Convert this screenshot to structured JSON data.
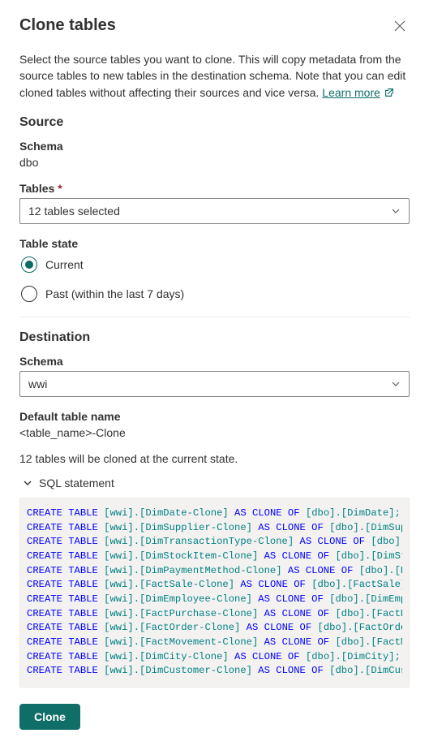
{
  "header": {
    "title": "Clone tables"
  },
  "intro": {
    "text": "Select the source tables you want to clone. This will copy metadata from the source tables to new tables in the destination schema. Note that you can edit cloned tables without affecting their sources and vice versa. ",
    "learn_more": "Learn more"
  },
  "source": {
    "title": "Source",
    "schema_label": "Schema",
    "schema_value": "dbo",
    "tables_label": "Tables",
    "tables_required": "*",
    "tables_selected": "12 tables selected",
    "state_label": "Table state",
    "state_current": "Current",
    "state_past": "Past (within the last 7 days)"
  },
  "destination": {
    "title": "Destination",
    "schema_label": "Schema",
    "schema_value": "wwi",
    "default_label": "Default table name",
    "default_value": "<table_name>-Clone"
  },
  "summary": "12 tables will be cloned at the current state.",
  "sql": {
    "label": "SQL statement",
    "kw_create": "CREATE",
    "kw_table": "TABLE",
    "kw_as": "AS",
    "kw_clone": "CLONE",
    "kw_of": "OF",
    "rows": [
      {
        "dest": "[wwi].[DimDate-Clone]",
        "src": "[dbo].[DimDate];"
      },
      {
        "dest": "[wwi].[DimSupplier-Clone]",
        "src": "[dbo].[DimSupplier];"
      },
      {
        "dest": "[wwi].[DimTransactionType-Clone]",
        "src": "[dbo].[DimTra"
      },
      {
        "dest": "[wwi].[DimStockItem-Clone]",
        "src": "[dbo].[DimStockItem"
      },
      {
        "dest": "[wwi].[DimPaymentMethod-Clone]",
        "src": "[dbo].[DimPayme"
      },
      {
        "dest": "[wwi].[FactSale-Clone]",
        "src": "[dbo].[FactSale];"
      },
      {
        "dest": "[wwi].[DimEmployee-Clone]",
        "src": "[dbo].[DimEmployee];"
      },
      {
        "dest": "[wwi].[FactPurchase-Clone]",
        "src": "[dbo].[FactPurchase"
      },
      {
        "dest": "[wwi].[FactOrder-Clone]",
        "src": "[dbo].[FactOrder];"
      },
      {
        "dest": "[wwi].[FactMovement-Clone]",
        "src": "[dbo].[FactMovement"
      },
      {
        "dest": "[wwi].[DimCity-Clone]",
        "src": "[dbo].[DimCity];"
      },
      {
        "dest": "[wwi].[DimCustomer-Clone]",
        "src": "[dbo].[DimCustomer];"
      }
    ]
  },
  "actions": {
    "clone": "Clone"
  }
}
